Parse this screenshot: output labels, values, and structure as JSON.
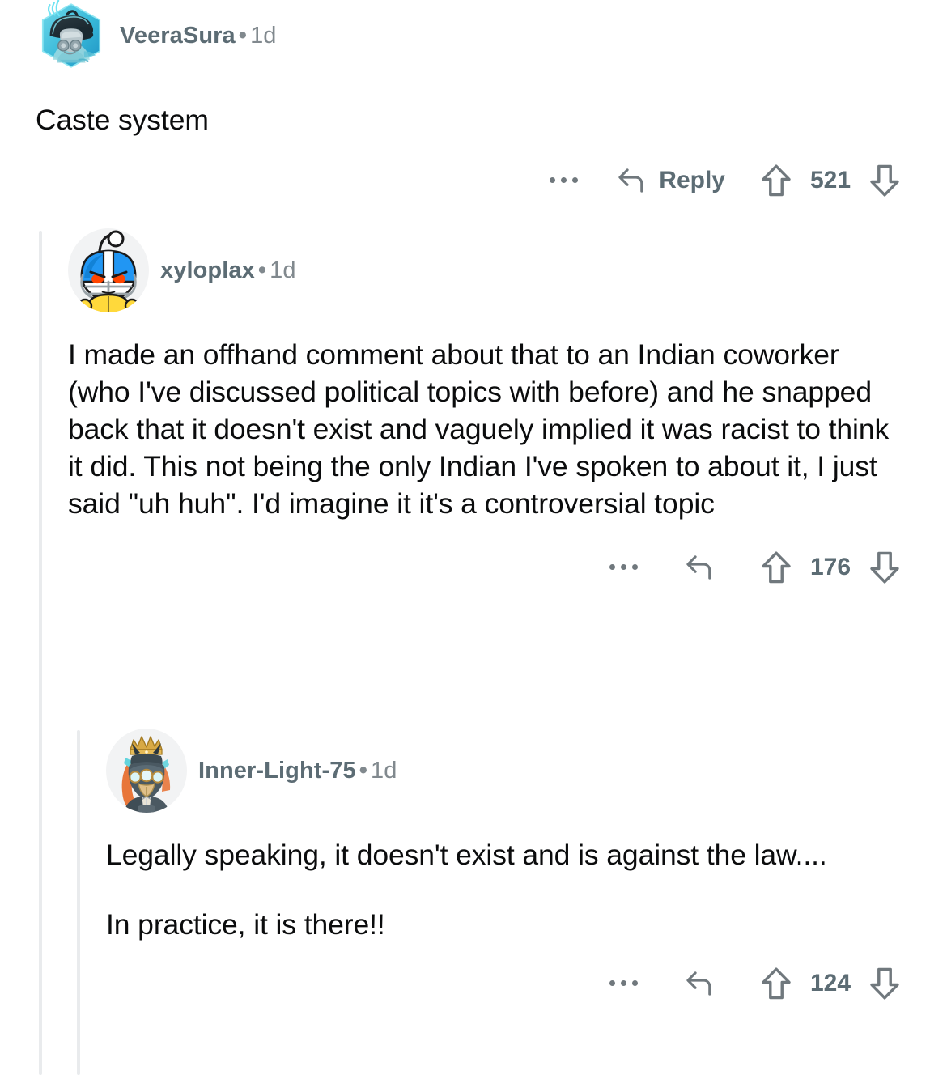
{
  "thread": {
    "comments": [
      {
        "id": "c0",
        "depth": 0,
        "author": "VeeraSura",
        "separator": "•",
        "timestamp": "1d",
        "avatar_name": "avatar-veerasura-gasmask",
        "paragraphs": [
          "Caste system"
        ],
        "actions": {
          "overflow_label": "...",
          "reply_label": "Reply",
          "show_reply_label": true,
          "upvote_label": "upvote",
          "downvote_label": "downvote",
          "score": "521"
        }
      },
      {
        "id": "c1",
        "depth": 1,
        "author": "xyloplax",
        "separator": "•",
        "timestamp": "1d",
        "avatar_name": "avatar-xyloplax-snoo-football",
        "paragraphs": [
          "I made an offhand comment about that to an Indian coworker (who I've discussed political topics with before) and he snapped back that it doesn't exist and vaguely implied it was racist to think it did. This not being the only Indian I've spoken to about it, I just said \"uh huh\". I'd imagine it it's a controversial topic"
        ],
        "actions": {
          "overflow_label": "...",
          "reply_label": "",
          "show_reply_label": false,
          "upvote_label": "upvote",
          "downvote_label": "downvote",
          "score": "176"
        }
      },
      {
        "id": "c2",
        "depth": 2,
        "author": "Inner-Light-75",
        "separator": "•",
        "timestamp": "1d",
        "avatar_name": "avatar-inner-light-75-armored",
        "paragraphs": [
          "Legally speaking, it doesn't exist and is against the law....",
          "In practice, it is there!!"
        ],
        "actions": {
          "overflow_label": "...",
          "reply_label": "",
          "show_reply_label": false,
          "upvote_label": "upvote",
          "downvote_label": "downvote",
          "score": "124"
        }
      }
    ]
  },
  "colors": {
    "background": "#ffffff",
    "body_text": "#0b0c0d",
    "meta_text": "#81898e",
    "username_text": "#5c6c74",
    "action_icon": "#70787d",
    "thread_line": "#e9ebed"
  }
}
